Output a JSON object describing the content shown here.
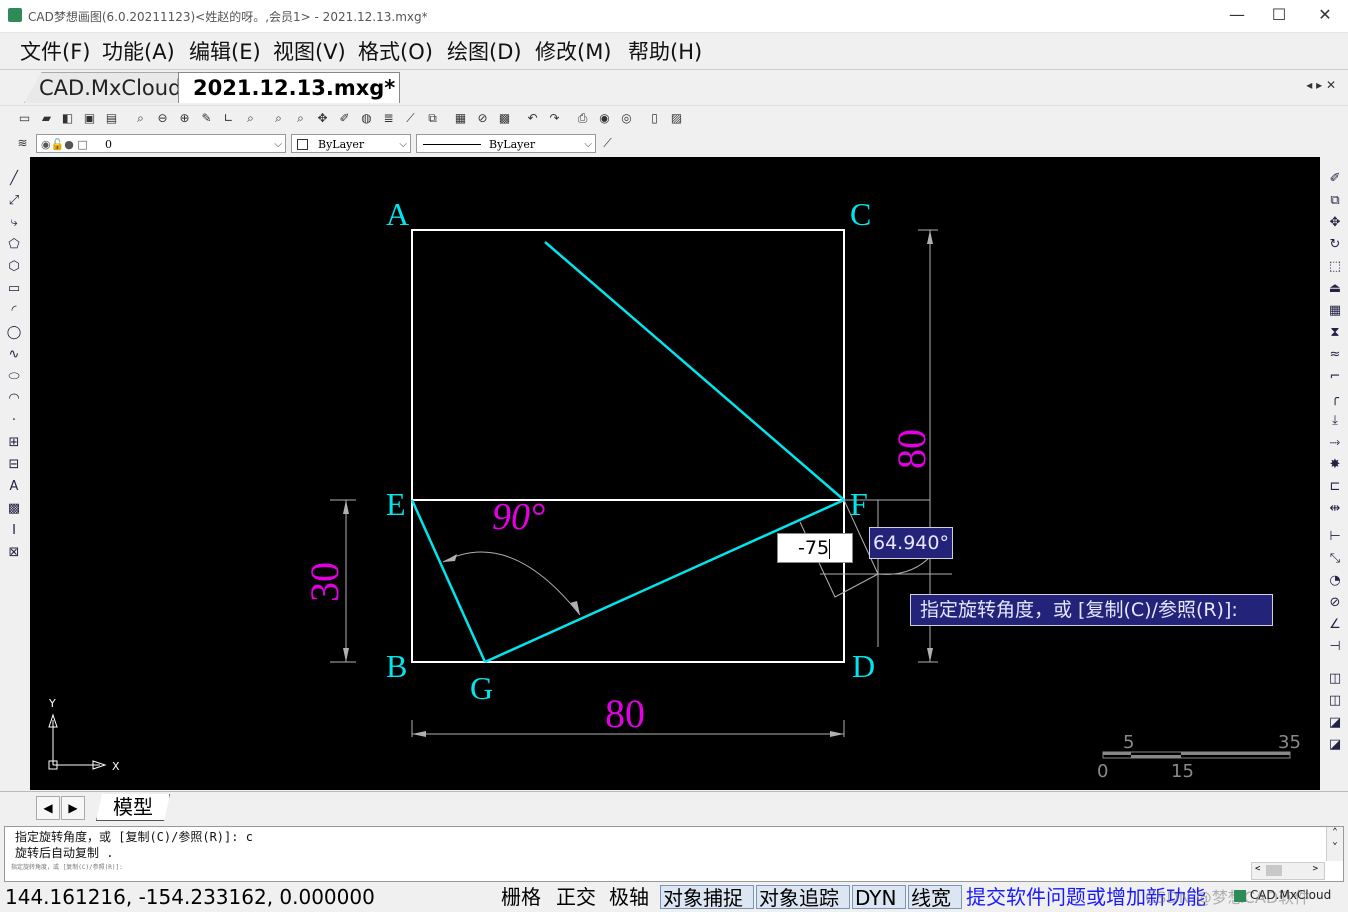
{
  "window": {
    "title": "CAD梦想画图(6.0.20211123)<姓赵的呀。,会员1> - 2021.12.13.mxg*",
    "minimize_glyph": "—",
    "maximize_glyph": "☐",
    "close_glyph": "✕"
  },
  "menu": {
    "items": [
      "文件(F)",
      "功能(A)",
      "编辑(E)",
      "视图(V)",
      "格式(O)",
      "绘图(D)",
      "修改(M)",
      "帮助(H)"
    ]
  },
  "tabs": {
    "items": [
      "CAD.MxCloud",
      "2021.12.13.mxg*"
    ],
    "close_glyph": "✕",
    "nav_glyph": "◂ ▸ ✕"
  },
  "toolbar": {
    "layer_combo": "0",
    "color_combo": "ByLayer",
    "linetype_combo": "ByLayer",
    "combo_arrow": "⌵"
  },
  "drawing": {
    "points": {
      "A": "A",
      "B": "B",
      "C": "C",
      "D": "D",
      "E": "E",
      "F": "F",
      "G": "G"
    },
    "dims": {
      "width": "80",
      "height": "80",
      "lower": "30",
      "angle": "90°"
    },
    "dynamic_input": "-75",
    "angle_readout": "64.940°",
    "prompt": "指定旋转角度，或 [复制(C)/参照(R)]:",
    "ucs": {
      "x": "X",
      "y": "Y"
    },
    "scale_labels": {
      "top_left": "5",
      "top_right": "35",
      "bottom_left": "0",
      "bottom_mid": "15"
    }
  },
  "layout": {
    "model_tab": "模型",
    "prev_glyph": "◀",
    "next_glyph": "▶"
  },
  "command": {
    "lines": [
      "指定旋转角度，或 [复制(C)/参照(R)]: c",
      "旋转后自动复制 ."
    ],
    "small_line": "指定旋转角度，或 [复制(C)/参照(R)]:",
    "scroll_up": "⌃",
    "scroll_down": "⌄",
    "hscroll_left": "<",
    "hscroll_right": ">"
  },
  "status": {
    "coords": "144.161216,  -154.233162,  0.000000",
    "buttons": [
      "栅格",
      "正交",
      "极轴",
      "对象捕捉",
      "对象追踪",
      "DYN",
      "线宽"
    ],
    "active": [
      false,
      false,
      false,
      true,
      true,
      true,
      true
    ],
    "feedback": "提交软件问题或增加新功能",
    "watermark": "CSDN @梦想CAD软件",
    "logo": "CAD.MxCloud"
  },
  "colors": {
    "cyan": "#00e5ee",
    "magenta": "#e300e3",
    "white": "#ffffff",
    "canvas": "#000000",
    "tooltip_bg": "#23237a"
  }
}
